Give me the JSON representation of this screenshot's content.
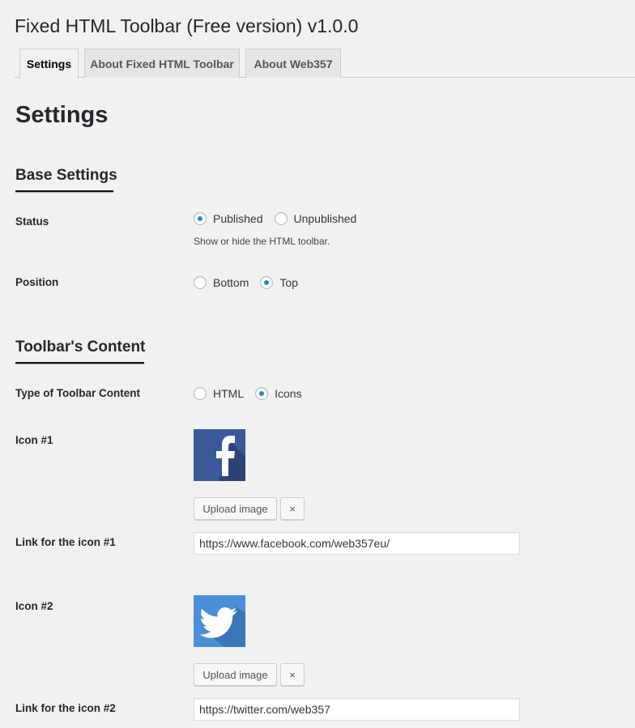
{
  "app": {
    "title": "Fixed HTML Toolbar (Free version) v1.0.0"
  },
  "tabs": [
    {
      "label": "Settings"
    },
    {
      "label": "About Fixed HTML Toolbar"
    },
    {
      "label": "About Web357"
    }
  ],
  "page": {
    "title": "Settings"
  },
  "base_settings": {
    "title": "Base Settings",
    "status": {
      "label": "Status",
      "options": [
        "Published",
        "Unpublished"
      ],
      "selected": "Published",
      "description": "Show or hide the HTML toolbar."
    },
    "position": {
      "label": "Position",
      "options": [
        "Bottom",
        "Top"
      ],
      "selected": "Top"
    }
  },
  "toolbar_content": {
    "title": "Toolbar's Content",
    "type": {
      "label": "Type of Toolbar Content",
      "options": [
        "HTML",
        "Icons"
      ],
      "selected": "Icons"
    },
    "icons": [
      {
        "label": "Icon #1",
        "image": "facebook-icon",
        "image_color": "#3b5998",
        "upload_label": "Upload image",
        "remove_label": "×",
        "link_label": "Link for the icon #1",
        "link_value": "https://www.facebook.com/web357eu/"
      },
      {
        "label": "Icon #2",
        "image": "twitter-icon",
        "image_color": "#4a90d9",
        "upload_label": "Upload image",
        "remove_label": "×",
        "link_label": "Link for the icon #2",
        "link_value": "https://twitter.com/web357"
      }
    ]
  },
  "colors": {
    "accent": "#1e8cbe",
    "background": "#f1f1f1"
  }
}
